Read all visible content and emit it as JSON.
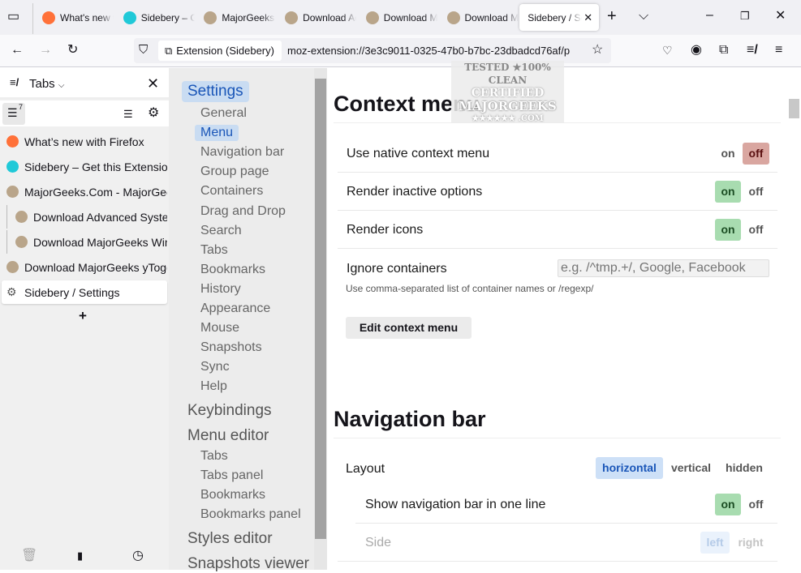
{
  "browser": {
    "tabs": [
      {
        "title": "What's new with Firefox",
        "icon": "firefox-icon",
        "color": "#ff7139"
      },
      {
        "title": "Sidebery – Get this Extension",
        "icon": "puzzle-icon",
        "color": "#20c9d8"
      },
      {
        "title": "MajorGeeks.Com",
        "icon": "majorgeeks-icon",
        "color": "#b9a58a"
      },
      {
        "title": "Download Advanced SystemCare",
        "icon": "majorgeeks-icon",
        "color": "#b9a58a"
      },
      {
        "title": "Download MajorGeeks",
        "icon": "majorgeeks-icon",
        "color": "#b9a58a"
      },
      {
        "title": "Download MajorGeeks yTog",
        "icon": "majorgeeks-icon",
        "color": "#b9a58a"
      },
      {
        "title": "Sidebery / Settings",
        "icon": "none",
        "color": "#fff"
      }
    ],
    "identity": "Extension (Sidebery)",
    "url": "moz-extension://3e3c9011-0325-47b0-b7bc-23dbadcd76af/p"
  },
  "watermark": {
    "line1": "TESTED ★100% CLEAN",
    "line2": "CERTIFIED",
    "line3": "MAJORGEEKS",
    "line4": ".COM"
  },
  "sidebar": {
    "panel_title": "Tabs",
    "tab_count": "7",
    "tabs": [
      {
        "title": "What’s new with Firefox",
        "color": "#ff7139",
        "indent": false
      },
      {
        "title": "Sidebery – Get this Extension",
        "color": "#20c9d8",
        "indent": false
      },
      {
        "title": "MajorGeeks.Com - MajorGeeks",
        "color": "#b9a58a",
        "indent": false
      },
      {
        "title": "Download Advanced SystemCare",
        "color": "#b9a58a",
        "indent": true
      },
      {
        "title": "Download MajorGeeks Windows",
        "color": "#b9a58a",
        "indent": true
      },
      {
        "title": "Download MajorGeeks yToggle",
        "color": "#b9a58a",
        "indent": false
      },
      {
        "title": "Sidebery / Settings",
        "color": "#666",
        "indent": false,
        "active": true
      }
    ],
    "new_tab": "+"
  },
  "settings_nav": {
    "title": "Settings",
    "sub": [
      "General",
      "Menu",
      "Navigation bar",
      "Group page",
      "Containers",
      "Drag and Drop",
      "Search",
      "Tabs",
      "Bookmarks",
      "History",
      "Appearance",
      "Mouse",
      "Snapshots",
      "Sync",
      "Help"
    ],
    "keybindings": "Keybindings",
    "menu_editor": "Menu editor",
    "menu_editor_sub": [
      "Tabs",
      "Tabs panel",
      "Bookmarks",
      "Bookmarks panel"
    ],
    "styles_editor": "Styles editor",
    "snapshots_viewer": "Snapshots viewer"
  },
  "content": {
    "context_menu": {
      "title": "Context menu",
      "native": {
        "label": "Use native context menu",
        "on": "on",
        "off": "off",
        "value": "off"
      },
      "inactive": {
        "label": "Render inactive options",
        "on": "on",
        "off": "off",
        "value": "on"
      },
      "icons": {
        "label": "Render icons",
        "on": "on",
        "off": "off",
        "value": "on"
      },
      "ignore": {
        "label": "Ignore containers",
        "placeholder": "e.g. /^tmp.+/, Google, Facebook",
        "note": "Use comma-separated list of container names or /regexp/"
      },
      "edit_button": "Edit context menu"
    },
    "nav_bar": {
      "title": "Navigation bar",
      "layout": {
        "label": "Layout",
        "options": [
          "horizontal",
          "vertical",
          "hidden"
        ],
        "value": "horizontal"
      },
      "one_line": {
        "label": "Show navigation bar in one line",
        "on": "on",
        "off": "off",
        "value": "on"
      },
      "side": {
        "label": "Side",
        "left": "left",
        "right": "right",
        "value": "left"
      }
    }
  }
}
